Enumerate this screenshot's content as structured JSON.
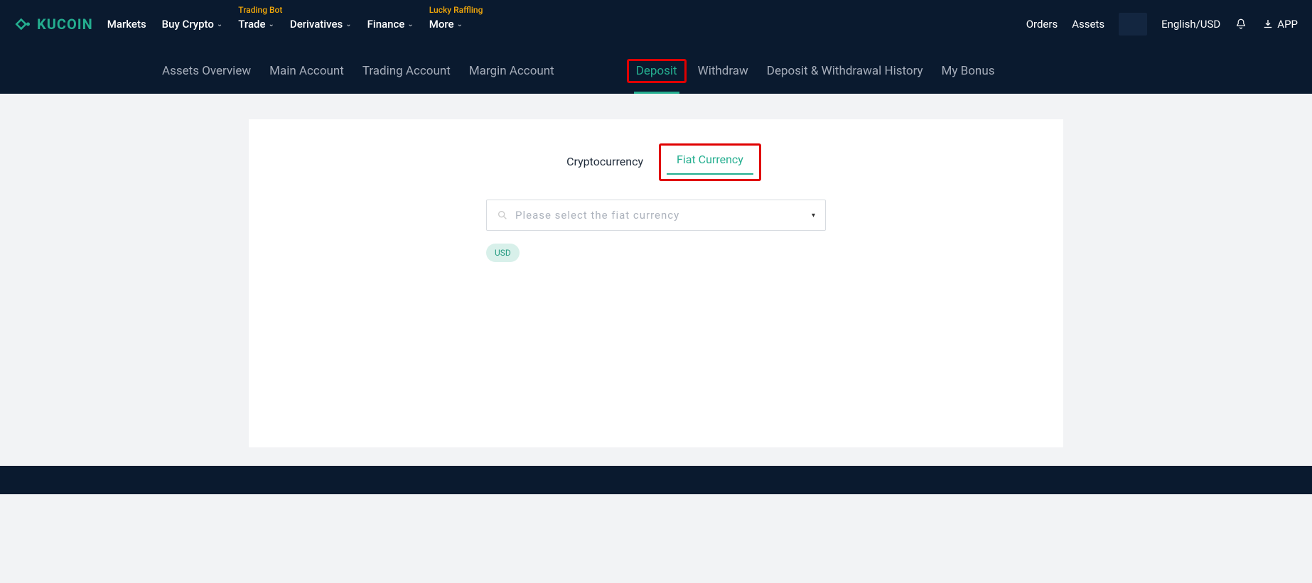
{
  "brand": {
    "name": "KUCOIN"
  },
  "topnav": {
    "left": [
      {
        "label": "Markets",
        "badge": null,
        "chevron": false
      },
      {
        "label": "Buy Crypto",
        "badge": null,
        "chevron": true
      },
      {
        "label": "Trade",
        "badge": "Trading Bot",
        "chevron": true
      },
      {
        "label": "Derivatives",
        "badge": null,
        "chevron": true
      },
      {
        "label": "Finance",
        "badge": null,
        "chevron": true
      },
      {
        "label": "More",
        "badge": "Lucky Raffling",
        "chevron": true
      }
    ],
    "right": {
      "orders": "Orders",
      "assets": "Assets",
      "lang": "English/USD",
      "app": "APP"
    }
  },
  "subnav": {
    "items_left": [
      "Assets Overview",
      "Main Account",
      "Trading Account",
      "Margin Account"
    ],
    "items_right": [
      {
        "label": "Deposit",
        "active": true,
        "highlighted": true
      },
      {
        "label": "Withdraw",
        "active": false
      },
      {
        "label": "Deposit & Withdrawal History",
        "active": false
      },
      {
        "label": "My Bonus",
        "active": false
      }
    ]
  },
  "main": {
    "tabs": [
      {
        "label": "Cryptocurrency",
        "active": false,
        "highlighted": false
      },
      {
        "label": "Fiat Currency",
        "active": true,
        "highlighted": true
      }
    ],
    "select_placeholder": "Please select the fiat currency",
    "quick_chips": [
      "USD"
    ]
  },
  "icons": {
    "chevron": "⌄"
  },
  "colors": {
    "accent": "#24ae8f",
    "nav_bg": "#0a1a2f",
    "badge_text": "#f0a70a",
    "highlight_border": "#e00000"
  }
}
